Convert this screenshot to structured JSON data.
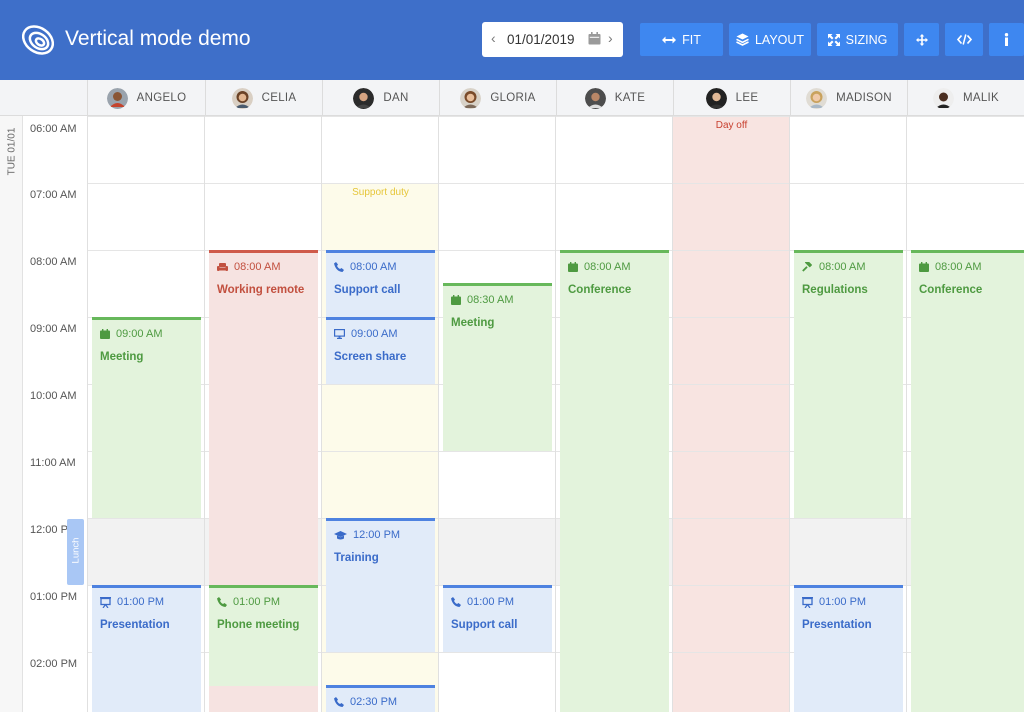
{
  "app": {
    "title": "Vertical mode demo",
    "date": "01/01/2019",
    "accent_color": "#3e6fc9",
    "button_color": "#3e87f0"
  },
  "toolbar": {
    "fit_label": "FIT",
    "layout_label": "LAYOUT",
    "sizing_label": "SIZING",
    "icons": [
      "arrows-horizontal-icon",
      "layers-icon",
      "expand-icon",
      "move-icon",
      "code-icon",
      "info-icon"
    ]
  },
  "day_label": "TUE 01/01",
  "times": [
    "06:00 AM",
    "07:00 AM",
    "08:00 AM",
    "09:00 AM",
    "10:00 AM",
    "11:00 AM",
    "12:00 PM",
    "01:00 PM",
    "02:00 PM"
  ],
  "resources": [
    "ANGELO",
    "CELIA",
    "DAN",
    "GLORIA",
    "KATE",
    "LEE",
    "MADISON",
    "MALIK"
  ],
  "background_labels": {
    "support_duty": "Support duty",
    "day_off": "Day off",
    "lunch": "Lunch"
  },
  "events": [
    {
      "resource": "ANGELO",
      "time": "09:00 AM",
      "name": "Meeting",
      "icon": "calendar-icon",
      "color": "green"
    },
    {
      "resource": "ANGELO",
      "time": "01:00 PM",
      "name": "Presentation",
      "icon": "presentation-icon",
      "color": "blue"
    },
    {
      "resource": "CELIA",
      "time": "08:00 AM",
      "name": "Working remote",
      "icon": "couch-icon",
      "color": "red"
    },
    {
      "resource": "CELIA",
      "time": "01:00 PM",
      "name": "Phone meeting",
      "icon": "phone-icon",
      "color": "green"
    },
    {
      "resource": "DAN",
      "time": "08:00 AM",
      "name": "Support call",
      "icon": "phone-icon",
      "color": "blue"
    },
    {
      "resource": "DAN",
      "time": "09:00 AM",
      "name": "Screen share",
      "icon": "monitor-icon",
      "color": "blue"
    },
    {
      "resource": "DAN",
      "time": "12:00 PM",
      "name": "Training",
      "icon": "graduation-cap-icon",
      "color": "blue"
    },
    {
      "resource": "DAN",
      "time": "02:30 PM",
      "name": "",
      "icon": "phone-icon",
      "color": "blue"
    },
    {
      "resource": "GLORIA",
      "time": "08:30 AM",
      "name": "Meeting",
      "icon": "calendar-icon",
      "color": "green"
    },
    {
      "resource": "GLORIA",
      "time": "01:00 PM",
      "name": "Support call",
      "icon": "phone-icon",
      "color": "blue"
    },
    {
      "resource": "KATE",
      "time": "08:00 AM",
      "name": "Conference",
      "icon": "calendar-icon",
      "color": "green"
    },
    {
      "resource": "MADISON",
      "time": "08:00 AM",
      "name": "Regulations",
      "icon": "hammer-icon",
      "color": "green"
    },
    {
      "resource": "MADISON",
      "time": "01:00 PM",
      "name": "Presentation",
      "icon": "presentation-icon",
      "color": "blue"
    },
    {
      "resource": "MALIK",
      "time": "08:00 AM",
      "name": "Conference",
      "icon": "calendar-icon",
      "color": "green"
    }
  ]
}
